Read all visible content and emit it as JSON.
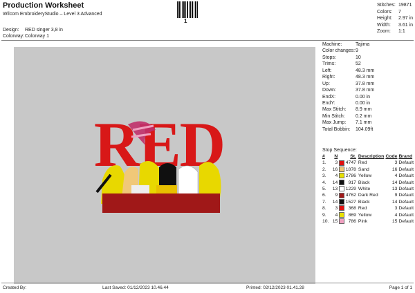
{
  "header": {
    "title": "Production Worksheet",
    "subtitle": "Wilcom EmbroideryStudio – Level 3 Advanced",
    "barcode_number": "1",
    "design_label": "Design:",
    "design_value": "RED singer 3,8 in",
    "colorway_label": "Colorway:",
    "colorway_value": "Colorway 1"
  },
  "stats": [
    {
      "label": "Stitches:",
      "value": "19871"
    },
    {
      "label": "Colors:",
      "value": "7"
    },
    {
      "label": "Height:",
      "value": "2.97 in"
    },
    {
      "label": "Width:",
      "value": "3.61 in"
    },
    {
      "label": "Zoom:",
      "value": "1:1"
    }
  ],
  "design_text": "RED",
  "machine_info": [
    {
      "label": "Machine:",
      "value": "Tajima"
    },
    {
      "label": "Color changes:",
      "value": "9"
    },
    {
      "label": "Stops:",
      "value": "10"
    },
    {
      "label": "Trims:",
      "value": "52"
    },
    {
      "label": "Left:",
      "value": "48.3 mm"
    },
    {
      "label": "Right:",
      "value": "48.3 mm"
    },
    {
      "label": "Up:",
      "value": "37.8 mm"
    },
    {
      "label": "Down:",
      "value": "37.8 mm"
    },
    {
      "label": "EndX:",
      "value": "0.00 in"
    },
    {
      "label": "EndY:",
      "value": "0.00 in"
    },
    {
      "label": "Max Stitch:",
      "value": "8.9 mm"
    },
    {
      "label": "Min Stitch:",
      "value": "0.2 mm"
    },
    {
      "label": "Max Jump:",
      "value": "7.1 mm"
    },
    {
      "label": "Total Bobbin:",
      "value": "104.09ft"
    }
  ],
  "stop_sequence": {
    "title": "Stop Sequence:",
    "columns": [
      "#",
      "N",
      "St.",
      "Description",
      "Code",
      "Brand"
    ],
    "rows": [
      {
        "n": "1.",
        "needle": "3",
        "color": "#e01010",
        "stitches": "4747",
        "desc": "Red",
        "code": "3",
        "brand": "Default"
      },
      {
        "n": "2.",
        "needle": "16",
        "color": "#f0c878",
        "stitches": "1878",
        "desc": "Sand",
        "code": "16",
        "brand": "Default"
      },
      {
        "n": "3.",
        "needle": "4",
        "color": "#e8e000",
        "stitches": "2786",
        "desc": "Yellow",
        "code": "4",
        "brand": "Default"
      },
      {
        "n": "4.",
        "needle": "14",
        "color": "#101010",
        "stitches": "917",
        "desc": "Black",
        "code": "14",
        "brand": "Default"
      },
      {
        "n": "5.",
        "needle": "13",
        "color": "#ffffff",
        "stitches": "1229",
        "desc": "White",
        "code": "13",
        "brand": "Default"
      },
      {
        "n": "6.",
        "needle": "9",
        "color": "#a01818",
        "stitches": "4762",
        "desc": "Dark Red",
        "code": "9",
        "brand": "Default"
      },
      {
        "n": "7.",
        "needle": "14",
        "color": "#101010",
        "stitches": "1527",
        "desc": "Black",
        "code": "14",
        "brand": "Default"
      },
      {
        "n": "8.",
        "needle": "3",
        "color": "#e01010",
        "stitches": "368",
        "desc": "Red",
        "code": "3",
        "brand": "Default"
      },
      {
        "n": "9.",
        "needle": "4",
        "color": "#e8e000",
        "stitches": "869",
        "desc": "Yellow",
        "code": "4",
        "brand": "Default"
      },
      {
        "n": "10.",
        "needle": "15",
        "color": "#f0a0c0",
        "stitches": "786",
        "desc": "Pink",
        "code": "15",
        "brand": "Default"
      }
    ]
  },
  "footer": {
    "created_by": "Created By:",
    "last_saved": "Last Saved: 01/12/2023 10.46.44",
    "printed": "Printed: 02/12/2023 01.41.28",
    "page": "Page 1 of 1"
  }
}
